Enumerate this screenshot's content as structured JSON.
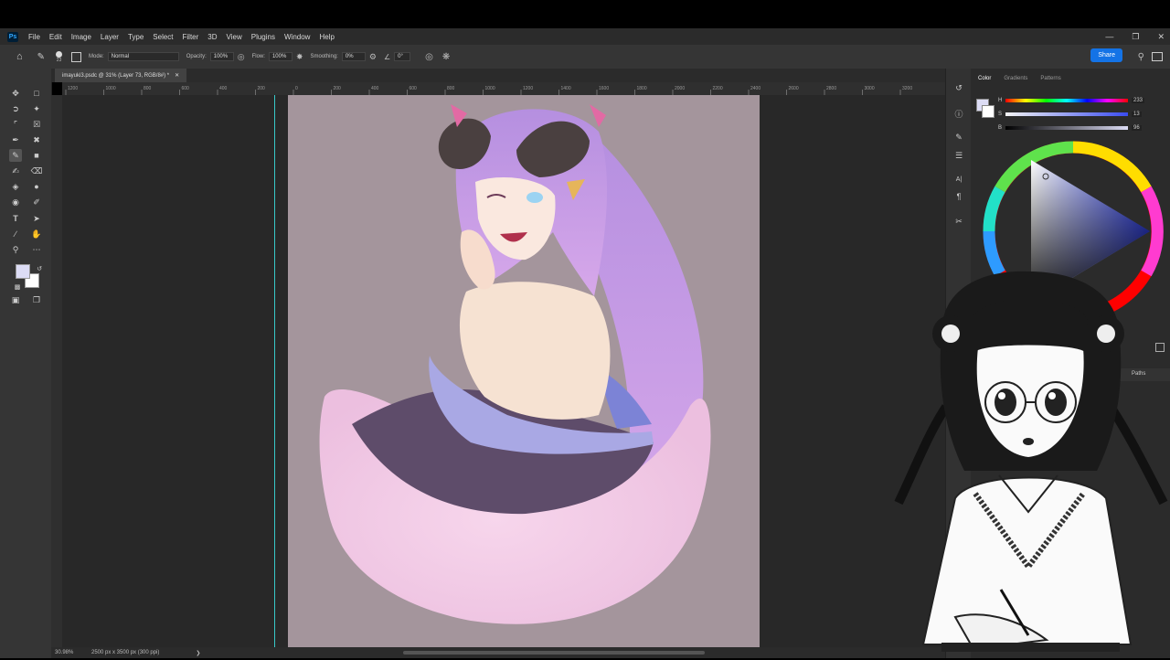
{
  "app": {
    "logo": "Ps",
    "menu": [
      "File",
      "Edit",
      "Image",
      "Layer",
      "Type",
      "Select",
      "Filter",
      "3D",
      "View",
      "Plugins",
      "Window",
      "Help"
    ]
  },
  "options": {
    "mode_label": "Mode:",
    "mode_value": "Normal",
    "opacity_label": "Opacity:",
    "opacity_value": "100%",
    "flow_label": "Flow:",
    "flow_value": "100%",
    "smoothing_label": "Smoothing:",
    "smoothing_value": "0%",
    "angle_value": "0°",
    "brush_size": "23",
    "share_label": "Share"
  },
  "document": {
    "tab_title": "imayuki3.psdc @ 31% (Layer 73, RGB/8#) *",
    "zoom": "30.98%",
    "doc_info": "2500 px x 3500 px (300 ppi)"
  },
  "ruler_ticks": [
    "1200",
    "1000",
    "800",
    "600",
    "400",
    "200",
    "0",
    "200",
    "400",
    "600",
    "800",
    "1000",
    "1200",
    "1400",
    "1600",
    "1800",
    "2000",
    "2200",
    "2400",
    "2600",
    "2800",
    "3000",
    "3200"
  ],
  "color_panel": {
    "tabs": [
      "Color",
      "Gradients",
      "Patterns"
    ],
    "h_label": "H",
    "h_value": "233",
    "s_label": "S",
    "s_value": "13",
    "b_label": "B",
    "b_value": "96"
  },
  "layers_panel": {
    "tab_paths": "Paths"
  },
  "colors": {
    "foreground": "#dcdcf5",
    "background": "#ffffff",
    "accent": "#1473e6",
    "guide": "#38c9c9"
  }
}
